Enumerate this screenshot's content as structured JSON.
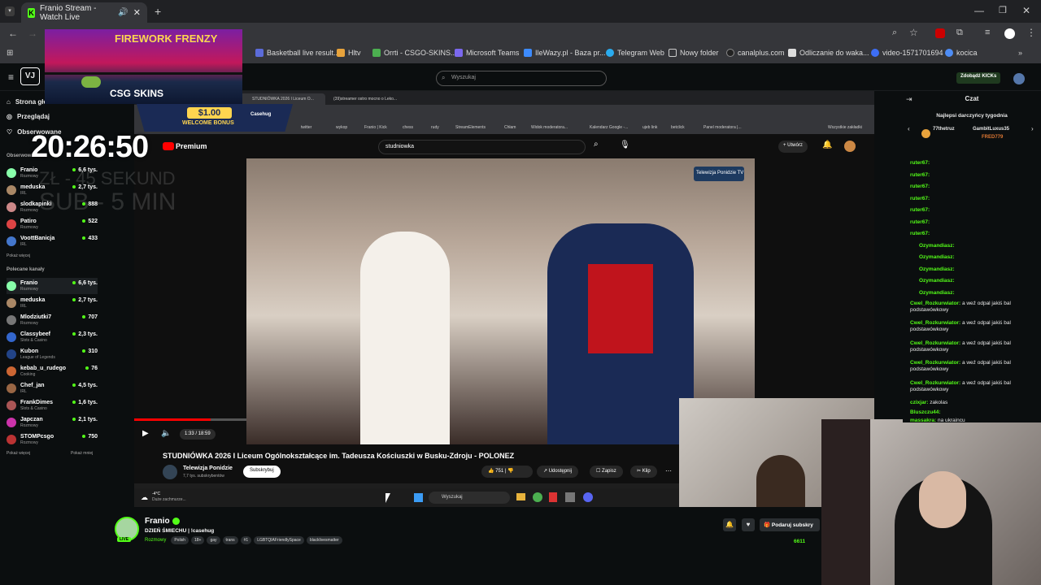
{
  "browser": {
    "tab_title": "Franio Stream - Watch Live",
    "bookmarks": [
      "Basketball live result...",
      "Hltv",
      "Orrti - CSGO-SKINS...",
      "Microsoft Teams",
      "IleWazy.pl - Baza pr...",
      "Telegram Web",
      "Nowy folder",
      "canalplus.com",
      "Odliczanie do waka...",
      "video-1571701694",
      "kocica"
    ]
  },
  "kick": {
    "search_placeholder": "Wyszukaj",
    "kicks_button": "Zdobądź KICKs",
    "nav": [
      "Strona główna",
      "Przeglądaj",
      "Obserwowane"
    ],
    "followed_title": "Obserwowane",
    "followed": [
      {
        "name": "Franio",
        "cat": "Rozmowy",
        "viewers": "6,6 tys."
      },
      {
        "name": "meduska",
        "cat": "IRL",
        "viewers": "2,7 tys."
      },
      {
        "name": "slodkapinki",
        "cat": "Rozmowy",
        "viewers": "888"
      },
      {
        "name": "Patiro",
        "cat": "Rozmowy",
        "viewers": "522"
      },
      {
        "name": "VoottBanicja",
        "cat": "IRL",
        "viewers": "433"
      }
    ],
    "show_more": "Pokaż więcej",
    "recommended_title": "Polecane kanały",
    "recommended": [
      {
        "name": "Franio",
        "cat": "Rozmowy",
        "viewers": "6,6 tys."
      },
      {
        "name": "meduska",
        "cat": "IRL",
        "viewers": "2,7 tys."
      },
      {
        "name": "Mlodziutki7",
        "cat": "Rozmowy",
        "viewers": "707"
      },
      {
        "name": "Classybeef",
        "cat": "Slots & Casino",
        "viewers": "2,3 tys."
      },
      {
        "name": "Kubon",
        "cat": "League of Legends",
        "viewers": "310"
      },
      {
        "name": "kebab_u_rudego",
        "cat": "Cooking",
        "viewers": "76"
      },
      {
        "name": "Chef_jan",
        "cat": "IRL",
        "viewers": "4,5 tys."
      },
      {
        "name": "FrankDimes",
        "cat": "Slots & Casino",
        "viewers": "1,6 tys."
      },
      {
        "name": "Japczan",
        "cat": "Rozmowy",
        "viewers": "2,1 tys."
      },
      {
        "name": "STOMPcsgo",
        "cat": "Rozmowy",
        "viewers": "750"
      }
    ],
    "show_more2": "Pokaż więcej",
    "show_less": "Pokaż mniej",
    "chat_title": "Czat",
    "top_gifters": "Najlepsi darczyńcy tygodnia",
    "gifters": [
      "77thetruz",
      "GambitLuxus35",
      "FRED779"
    ],
    "chat_lines": [
      {
        "user": "ruter67:",
        "text": ""
      },
      {
        "user": "ruter67:",
        "text": ""
      },
      {
        "user": "ruter67:",
        "text": ""
      },
      {
        "user": "ruter67:",
        "text": ""
      },
      {
        "user": "ruter67:",
        "text": ""
      },
      {
        "user": "ruter67:",
        "text": ""
      },
      {
        "user": "ruter67:",
        "text": ""
      },
      {
        "user": "Ozymandiasz:",
        "text": ""
      },
      {
        "user": "Ozymandiasz:",
        "text": ""
      },
      {
        "user": "Ozymandiasz:",
        "text": ""
      },
      {
        "user": "Ozymandiasz:",
        "text": ""
      },
      {
        "user": "Ozymandiasz:",
        "text": ""
      },
      {
        "user": "Cwel_Rozkurwiator:",
        "text": "a weź odpal jakiś bal podstawówkowy"
      },
      {
        "user": "Cwel_Rozkurwiator:",
        "text": "a weź odpal jakiś bal podstawówkowy"
      },
      {
        "user": "Cwel_Rozkurwiator:",
        "text": "a weź odpal jakiś bal podstawówkowy"
      },
      {
        "user": "Cwel_Rozkurwiator:",
        "text": "a weź odpal jakiś bal podstawówkowy"
      },
      {
        "user": "Cwel_Rozkurwiator:",
        "text": "a weź odpal jakiś bal podstawówkowy"
      },
      {
        "user": "czixjar:",
        "text": "zakolas"
      },
      {
        "user": "Bluszczu44:",
        "text": ""
      },
      {
        "user": "massakra:",
        "text": "na ukraincu"
      }
    ],
    "streamer": {
      "name": "Franio",
      "title": "DZIEŃ ŚMIECHU | !casehug",
      "category": "Rozmowy",
      "tags": [
        "Polish",
        "18+",
        "gay",
        "trans",
        "#1",
        "LGBTQIAFriendlySpace",
        "blacklivesmatter"
      ],
      "subscribe": "Podaruj subskry",
      "viewers": "6611"
    }
  },
  "overlay": {
    "clock": "20:26:50",
    "ghost_line1": "ZŁ - 45 SEKUND",
    "ghost_line2": "SUB - 5 MIN",
    "ad_title": "FIREWORK FRENZY",
    "ad_brand": "CSG SKINS",
    "bonus": "$1.00",
    "bonus_label": "WELCOME BONUS",
    "casehug": "Casehug"
  },
  "inner_browser": {
    "tabs": [
      "STUDNIÓWKA 2026 I Liceum O...",
      "(39)streamer ostro mocno o Leko..."
    ],
    "bookmarks": [
      "twitter",
      "wykop",
      "Franio | Kick",
      "chess",
      "rudy",
      "StreamElements",
      "Chłam",
      "Widok moderatora...",
      "Kalendarz Google -...",
      "ujeb link",
      "betclick",
      "Panel moderatora |..."
    ],
    "all_bookmarks": "Wszystkie zakładki"
  },
  "youtube": {
    "logo": "Premium",
    "search_value": "studniowka",
    "create": "Utwórz",
    "video_title": "STUDNIÓWKA 2026 I Liceum Ogólnokształcące im. Tadeusza Kościuszki w Busku-Zdroju - POLONEZ",
    "time": "1:33 / 18:59",
    "channel": "Telewizja Ponidzie",
    "subs": "7,7 tys. subskrybentów",
    "subscribe": "Subskrybuj",
    "likes": "751",
    "share": "Udostępnij",
    "save": "Zapisz",
    "clip": "Klip",
    "watermark": "Telewizja Ponidzie TV"
  },
  "taskbar": {
    "weather": "-4°C",
    "weather_desc": "Duże zachmurze...",
    "search": "Wyszukaj"
  }
}
